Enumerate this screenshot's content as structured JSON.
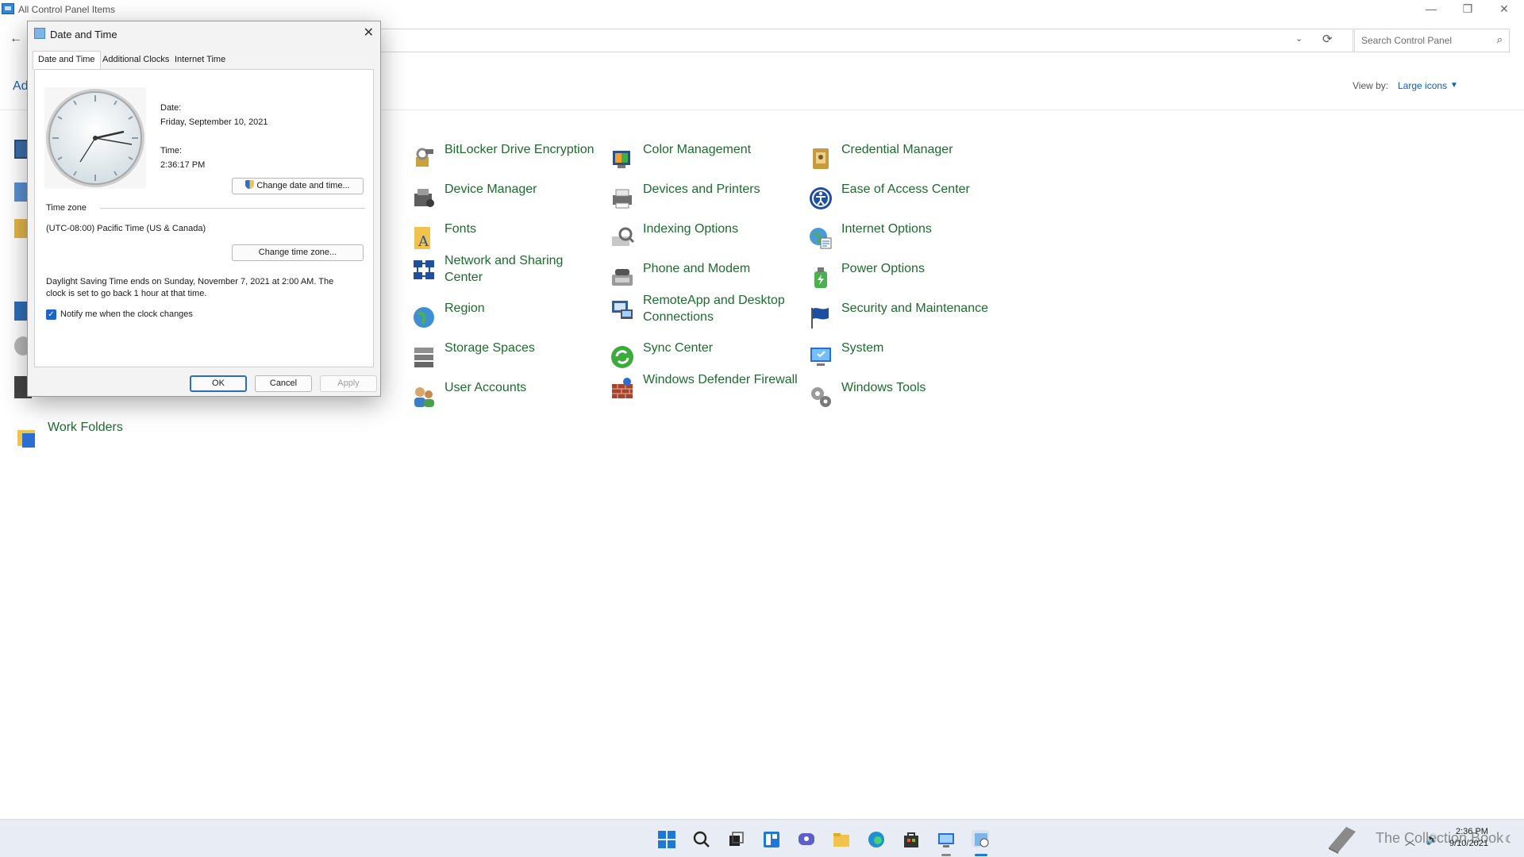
{
  "window": {
    "title": "All Control Panel Items",
    "search_placeholder": "Search Control Panel",
    "view_by_label": "View by:",
    "view_by_value": "Large icons",
    "adjust_text": "Ad"
  },
  "items": [
    {
      "label": "BitLocker Drive Encryption",
      "icon": "bitlocker-icon"
    },
    {
      "label": "Color Management",
      "icon": "color-management-icon"
    },
    {
      "label": "Credential Manager",
      "icon": "credential-manager-icon"
    },
    {
      "label": "Device Manager",
      "icon": "device-manager-icon"
    },
    {
      "label": "Devices and Printers",
      "icon": "devices-printers-icon"
    },
    {
      "label": "Ease of Access Center",
      "icon": "ease-of-access-icon"
    },
    {
      "label": "Fonts",
      "icon": "fonts-icon"
    },
    {
      "label": "Indexing Options",
      "icon": "indexing-icon"
    },
    {
      "label": "Internet Options",
      "icon": "internet-options-icon"
    },
    {
      "label": "Network and Sharing Center",
      "icon": "network-icon"
    },
    {
      "label": "Phone and Modem",
      "icon": "phone-modem-icon"
    },
    {
      "label": "Power Options",
      "icon": "power-options-icon"
    },
    {
      "label": "Region",
      "icon": "region-icon"
    },
    {
      "label": "RemoteApp and Desktop Connections",
      "icon": "remoteapp-icon"
    },
    {
      "label": "Security and Maintenance",
      "icon": "security-flag-icon"
    },
    {
      "label": "Storage Spaces",
      "icon": "storage-spaces-icon"
    },
    {
      "label": "Sync Center",
      "icon": "sync-center-icon"
    },
    {
      "label": "System",
      "icon": "system-icon"
    },
    {
      "label": "User Accounts",
      "icon": "user-accounts-icon"
    },
    {
      "label": "Windows Defender Firewall",
      "icon": "firewall-icon"
    },
    {
      "label": "Windows Tools",
      "icon": "windows-tools-icon"
    },
    {
      "label": "Work Folders",
      "icon": "work-folders-icon"
    }
  ],
  "dialog": {
    "title": "Date and Time",
    "tabs": [
      "Date and Time",
      "Additional Clocks",
      "Internet Time"
    ],
    "date_label": "Date:",
    "date_value": "Friday, September 10, 2021",
    "time_label": "Time:",
    "time_value": "2:36:17 PM",
    "change_datetime_btn": "Change date and time...",
    "timezone_header": "Time zone",
    "timezone_value": "(UTC-08:00) Pacific Time (US & Canada)",
    "change_tz_btn": "Change time zone...",
    "dst_text": "Daylight Saving Time ends on Sunday, November 7, 2021 at 2:00 AM. The clock is set to go back 1 hour at that time.",
    "notify_label": "Notify me when the clock changes",
    "notify_checked": true,
    "ok": "OK",
    "cancel": "Cancel",
    "apply": "Apply"
  },
  "taskbar": {
    "watermark": "The Collection Book",
    "clock_time": "2:36 PM",
    "clock_date": "9/10/2021"
  },
  "colors": {
    "link_green": "#1d6b2e",
    "accent_blue": "#1e63c9",
    "taskbar_bg": "#e8edf5"
  }
}
